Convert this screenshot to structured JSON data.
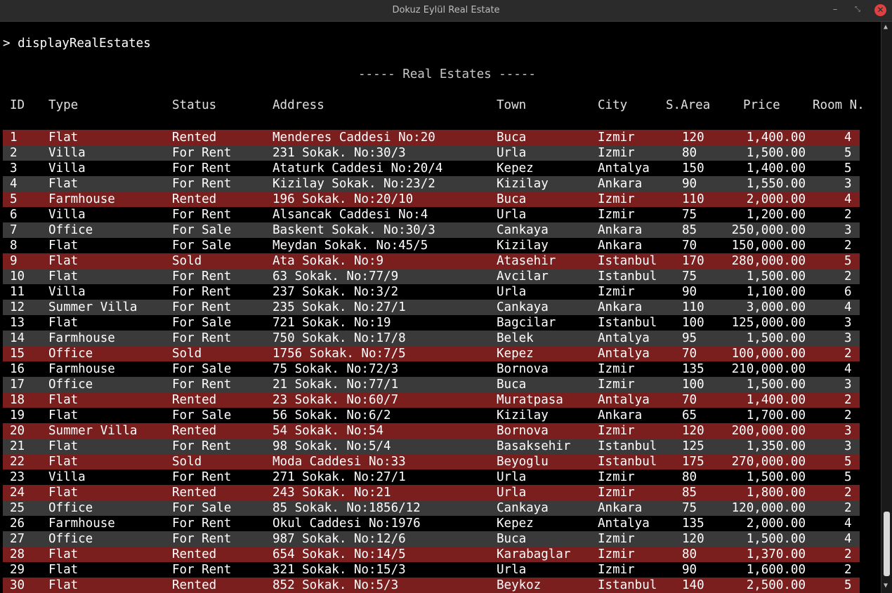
{
  "window": {
    "title": "Dokuz Eylül Real Estate",
    "minimize": "–",
    "restore": "⤡",
    "close": "✕"
  },
  "terminal": {
    "prompt": "> displayRealEstates",
    "heading": "----- Real Estates -----",
    "columns": [
      "ID",
      "Type",
      "Status",
      "Address",
      "Town",
      "City",
      "S.Area",
      "Price",
      "Room N."
    ],
    "rows": [
      {
        "id": "1",
        "type": "Flat",
        "status": "Rented",
        "address": "Menderes Caddesi No:20",
        "town": "Buca",
        "city": "Izmir",
        "area": "120",
        "price": "1,400.00",
        "rooms": "4",
        "color": "red"
      },
      {
        "id": "2",
        "type": "Villa",
        "status": "For Rent",
        "address": "231 Sokak. No:30/3",
        "town": "Urla",
        "city": "Izmir",
        "area": "80",
        "price": "1,500.00",
        "rooms": "5",
        "color": "gray"
      },
      {
        "id": "3",
        "type": "Villa",
        "status": "For Rent",
        "address": "Ataturk Caddesi No:20/4",
        "town": "Kepez",
        "city": "Antalya",
        "area": "150",
        "price": "1,400.00",
        "rooms": "5",
        "color": "white"
      },
      {
        "id": "4",
        "type": "Flat",
        "status": "For Rent",
        "address": "Kizilay Sokak. No:23/2",
        "town": "Kizilay",
        "city": "Ankara",
        "area": "90",
        "price": "1,550.00",
        "rooms": "3",
        "color": "gray"
      },
      {
        "id": "5",
        "type": "Farmhouse",
        "status": "Rented",
        "address": "196 Sokak. No:20/10",
        "town": "Buca",
        "city": "Izmir",
        "area": "110",
        "price": "2,000.00",
        "rooms": "4",
        "color": "red"
      },
      {
        "id": "6",
        "type": "Villa",
        "status": "For Rent",
        "address": "Alsancak Caddesi No:4",
        "town": "Urla",
        "city": "Izmir",
        "area": "75",
        "price": "1,200.00",
        "rooms": "2",
        "color": "white"
      },
      {
        "id": "7",
        "type": "Office",
        "status": "For Sale",
        "address": "Baskent Sokak. No:30/3",
        "town": "Cankaya",
        "city": "Ankara",
        "area": "85",
        "price": "250,000.00",
        "rooms": "3",
        "color": "gray"
      },
      {
        "id": "8",
        "type": "Flat",
        "status": "For Sale",
        "address": "Meydan Sokak. No:45/5",
        "town": "Kizilay",
        "city": "Ankara",
        "area": "70",
        "price": "150,000.00",
        "rooms": "2",
        "color": "white"
      },
      {
        "id": "9",
        "type": "Flat",
        "status": "Sold",
        "address": "Ata Sokak. No:9",
        "town": "Atasehir",
        "city": "Istanbul",
        "area": "170",
        "price": "280,000.00",
        "rooms": "5",
        "color": "red"
      },
      {
        "id": "10",
        "type": "Flat",
        "status": "For Rent",
        "address": "63 Sokak. No:77/9",
        "town": "Avcilar",
        "city": "Istanbul",
        "area": "75",
        "price": "1,500.00",
        "rooms": "2",
        "color": "gray"
      },
      {
        "id": "11",
        "type": "Villa",
        "status": "For Rent",
        "address": "237 Sokak. No:3/2",
        "town": "Urla",
        "city": "Izmir",
        "area": "90",
        "price": "1,100.00",
        "rooms": "6",
        "color": "white"
      },
      {
        "id": "12",
        "type": "Summer Villa",
        "status": "For Rent",
        "address": "235 Sokak. No:27/1",
        "town": "Cankaya",
        "city": "Ankara",
        "area": "110",
        "price": "3,000.00",
        "rooms": "4",
        "color": "gray"
      },
      {
        "id": "13",
        "type": "Flat",
        "status": "For Sale",
        "address": "721 Sokak. No:19",
        "town": "Bagcilar",
        "city": "Istanbul",
        "area": "100",
        "price": "125,000.00",
        "rooms": "3",
        "color": "white"
      },
      {
        "id": "14",
        "type": "Farmhouse",
        "status": "For Rent",
        "address": "750 Sokak. No:17/8",
        "town": "Belek",
        "city": "Antalya",
        "area": "95",
        "price": "1,500.00",
        "rooms": "3",
        "color": "gray"
      },
      {
        "id": "15",
        "type": "Office",
        "status": "Sold",
        "address": "1756 Sokak. No:7/5",
        "town": "Kepez",
        "city": "Antalya",
        "area": "70",
        "price": "100,000.00",
        "rooms": "2",
        "color": "red"
      },
      {
        "id": "16",
        "type": "Farmhouse",
        "status": "For Sale",
        "address": "75 Sokak. No:72/3",
        "town": "Bornova",
        "city": "Izmir",
        "area": "135",
        "price": "210,000.00",
        "rooms": "4",
        "color": "white"
      },
      {
        "id": "17",
        "type": "Office",
        "status": "For Rent",
        "address": "21 Sokak. No:77/1",
        "town": "Buca",
        "city": "Izmir",
        "area": "100",
        "price": "1,500.00",
        "rooms": "3",
        "color": "gray"
      },
      {
        "id": "18",
        "type": "Flat",
        "status": "Rented",
        "address": "23 Sokak. No:60/7",
        "town": "Muratpasa",
        "city": "Antalya",
        "area": "70",
        "price": "1,400.00",
        "rooms": "2",
        "color": "red"
      },
      {
        "id": "19",
        "type": "Flat",
        "status": "For Sale",
        "address": "56 Sokak. No:6/2",
        "town": "Kizilay",
        "city": "Ankara",
        "area": "65",
        "price": "1,700.00",
        "rooms": "2",
        "color": "white"
      },
      {
        "id": "20",
        "type": "Summer Villa",
        "status": "Rented",
        "address": "54 Sokak. No:54",
        "town": "Bornova",
        "city": "Izmir",
        "area": "120",
        "price": "200,000.00",
        "rooms": "3",
        "color": "red"
      },
      {
        "id": "21",
        "type": "Flat",
        "status": "For Rent",
        "address": "98 Sokak. No:5/4",
        "town": "Basaksehir",
        "city": "Istanbul",
        "area": "125",
        "price": "1,350.00",
        "rooms": "3",
        "color": "gray"
      },
      {
        "id": "22",
        "type": "Flat",
        "status": "Sold",
        "address": "Moda Caddesi No:33",
        "town": "Beyoglu",
        "city": "Istanbul",
        "area": "175",
        "price": "270,000.00",
        "rooms": "5",
        "color": "red"
      },
      {
        "id": "23",
        "type": "Villa",
        "status": "For Rent",
        "address": "271 Sokak. No:27/1",
        "town": "Urla",
        "city": "Izmir",
        "area": "80",
        "price": "1,500.00",
        "rooms": "5",
        "color": "white"
      },
      {
        "id": "24",
        "type": "Flat",
        "status": "Rented",
        "address": "243 Sokak. No:21",
        "town": "Urla",
        "city": "Izmir",
        "area": "85",
        "price": "1,800.00",
        "rooms": "2",
        "color": "red"
      },
      {
        "id": "25",
        "type": "Office",
        "status": "For Sale",
        "address": "85 Sokak. No:1856/12",
        "town": "Cankaya",
        "city": "Ankara",
        "area": "75",
        "price": "120,000.00",
        "rooms": "2",
        "color": "gray"
      },
      {
        "id": "26",
        "type": "Farmhouse",
        "status": "For Rent",
        "address": "Okul Caddesi No:1976",
        "town": "Kepez",
        "city": "Antalya",
        "area": "135",
        "price": "2,000.00",
        "rooms": "4",
        "color": "white"
      },
      {
        "id": "27",
        "type": "Office",
        "status": "For Rent",
        "address": "987 Sokak. No:12/6",
        "town": "Buca",
        "city": "Izmir",
        "area": "120",
        "price": "1,500.00",
        "rooms": "4",
        "color": "gray"
      },
      {
        "id": "28",
        "type": "Flat",
        "status": "Rented",
        "address": "654 Sokak. No:14/5",
        "town": "Karabaglar",
        "city": "Izmir",
        "area": "80",
        "price": "1,370.00",
        "rooms": "2",
        "color": "red"
      },
      {
        "id": "29",
        "type": "Flat",
        "status": "For Rent",
        "address": "321 Sokak. No:15/3",
        "town": "Urla",
        "city": "Izmir",
        "area": "90",
        "price": "1,600.00",
        "rooms": "2",
        "color": "white"
      },
      {
        "id": "30",
        "type": "Flat",
        "status": "Rented",
        "address": "852 Sokak. No:5/3",
        "town": "Beykoz",
        "city": "Istanbul",
        "area": "140",
        "price": "2,500.00",
        "rooms": "5",
        "color": "red"
      }
    ]
  },
  "scrollbar": {
    "up": "▲",
    "down": "▼"
  },
  "colors": {
    "rented_row": "#7a1e1e",
    "alt_row": "#3a3a3a",
    "background": "#000000"
  }
}
